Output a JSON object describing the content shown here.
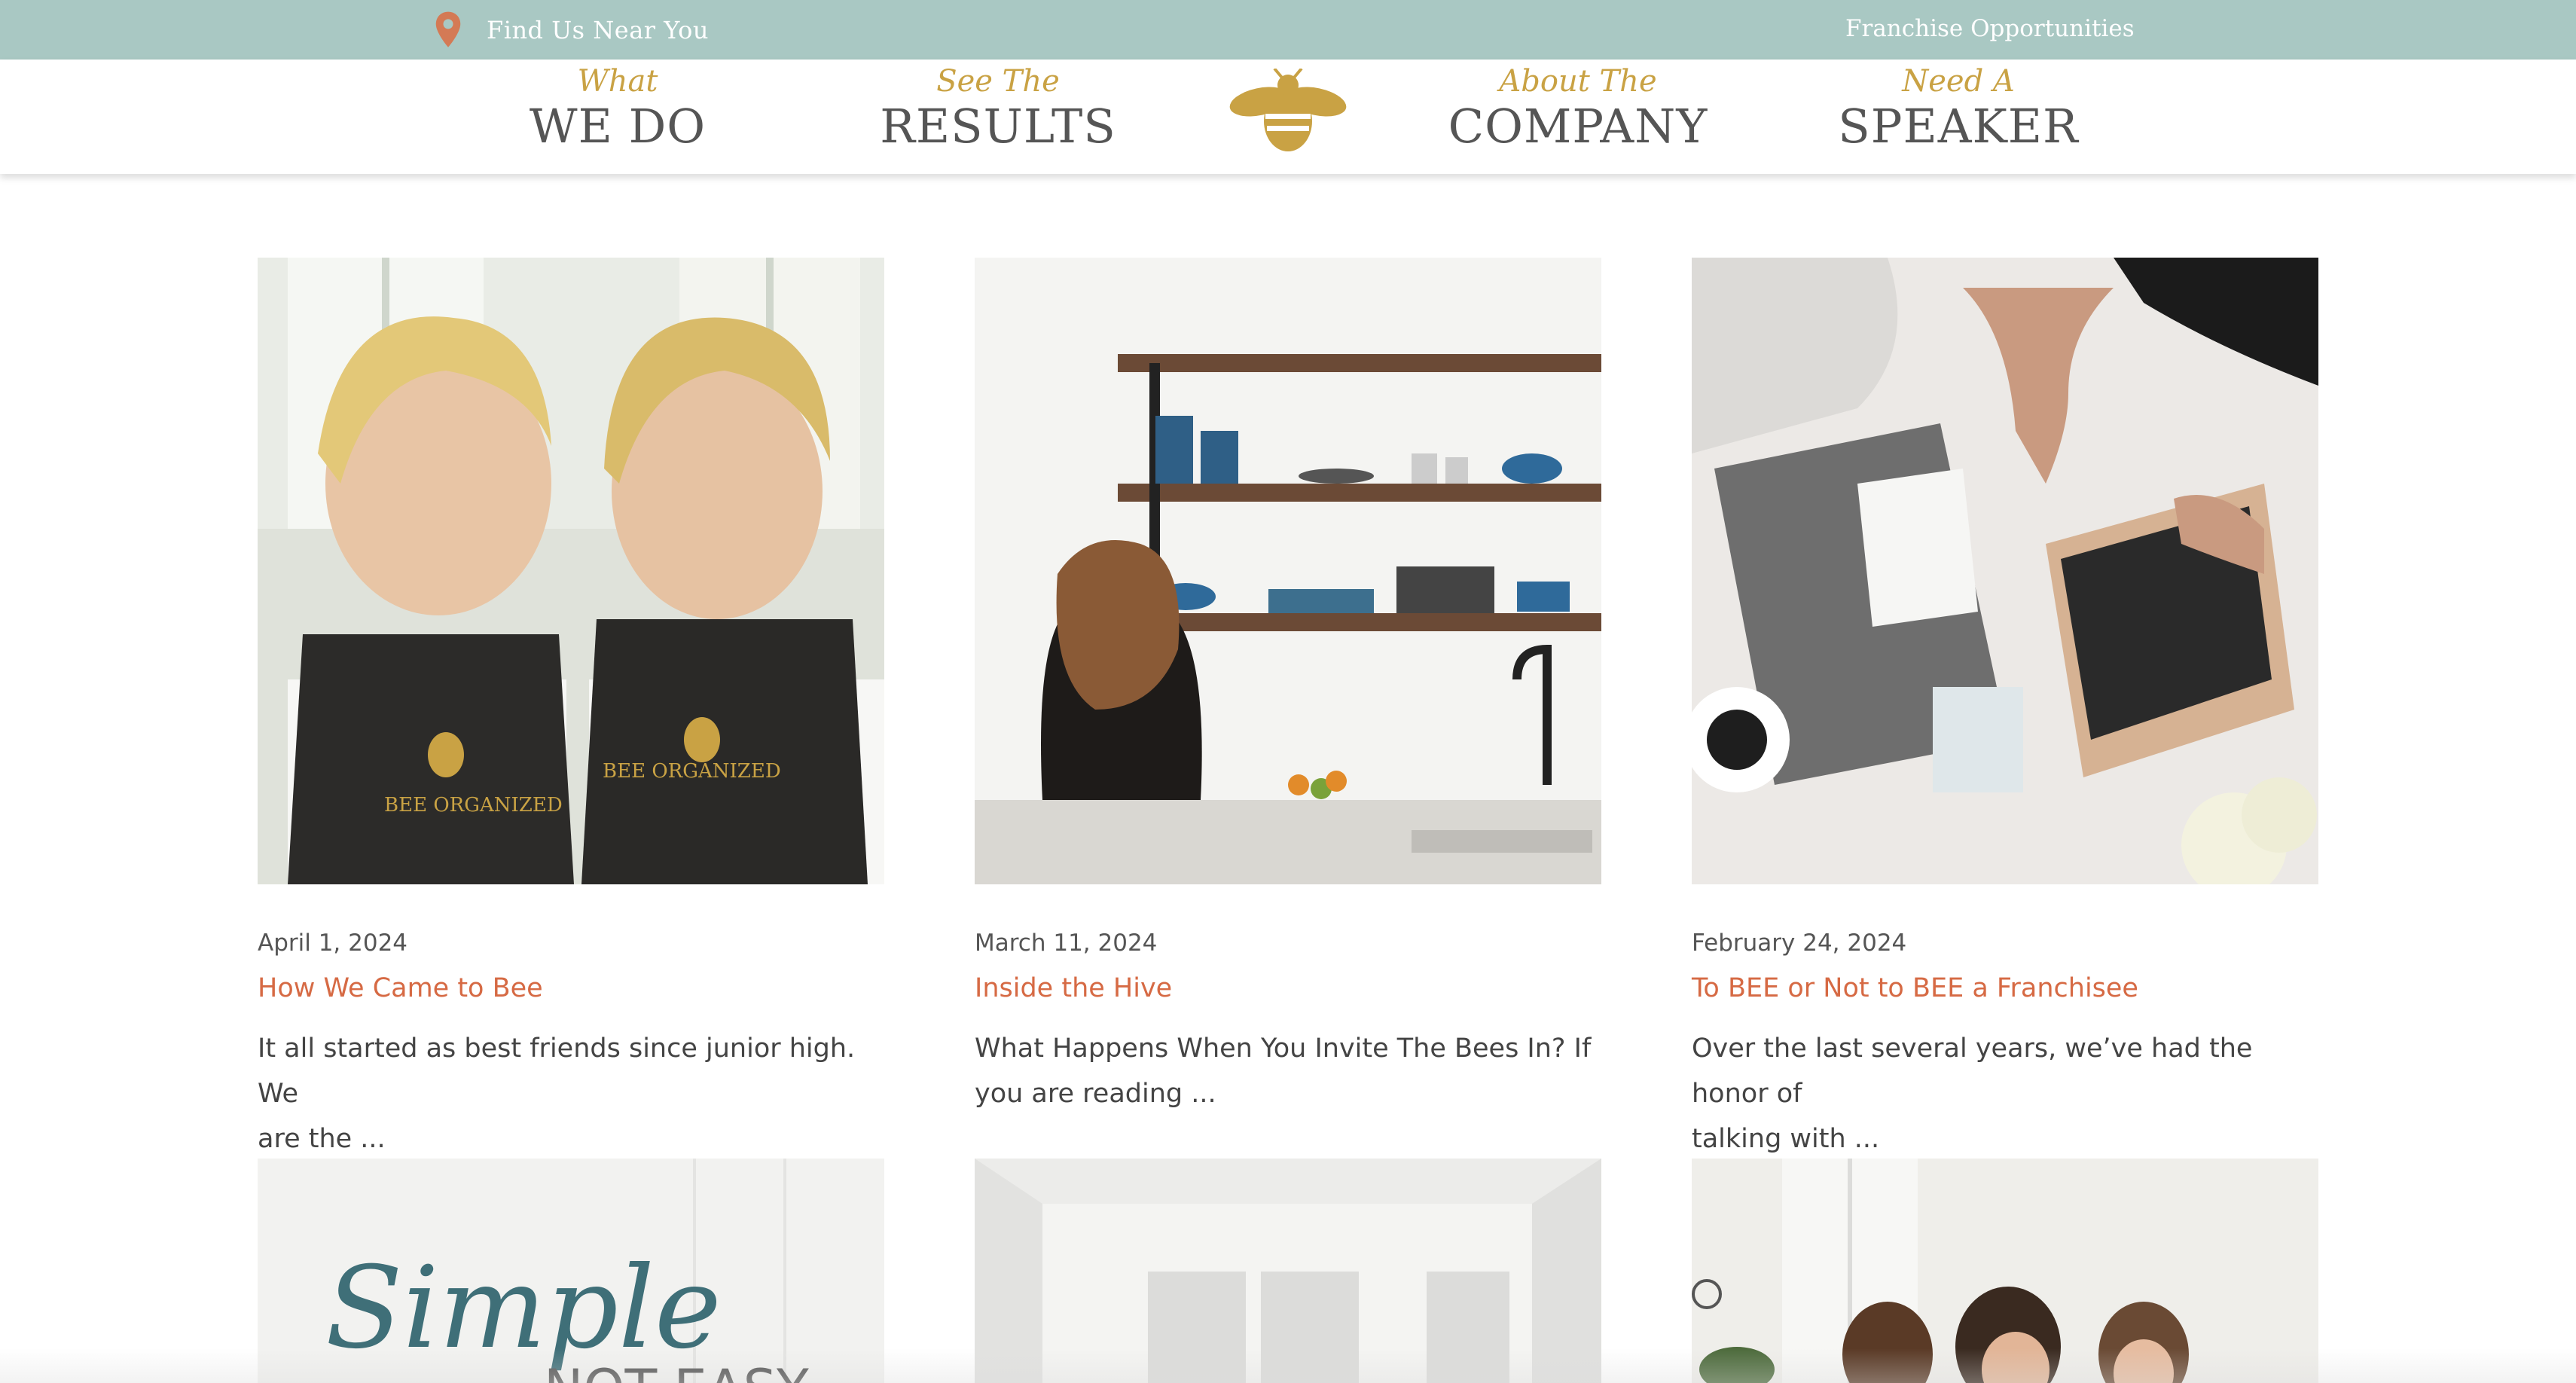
{
  "topbar": {
    "find_us": "Find Us Near You",
    "franchise": "Franchise Opportunities",
    "colors": {
      "bar": "#a9c8c3",
      "pin": "#d47a55"
    }
  },
  "nav": [
    {
      "script": "What",
      "main": "WE DO"
    },
    {
      "script": "See The",
      "main": "RESULTS"
    },
    {
      "script": "About The",
      "main": "COMPANY"
    },
    {
      "script": "Need A",
      "main": "SPEAKER"
    }
  ],
  "logo": {
    "icon": "bee-icon",
    "color": "#c9a244"
  },
  "posts": [
    {
      "date": "April 1, 2024",
      "title": "How We Came to Bee",
      "excerpt_line1": "It all started as best friends since junior high. We",
      "excerpt_line2": "are the ...",
      "image_text_1": "BEE ORGANIZED",
      "image_text_2": "BEE ORGANIZED"
    },
    {
      "date": "March 11, 2024",
      "title": "Inside the Hive",
      "excerpt_line1": "What Happens When You Invite The Bees In? If",
      "excerpt_line2": "you are reading ..."
    },
    {
      "date": "February 24, 2024",
      "title": "To BEE or Not to BEE a Franchisee",
      "excerpt_line1": "Over the last several years, we’ve had the honor of",
      "excerpt_line2": "talking with ..."
    }
  ],
  "second_row": {
    "image_text_script": "Simple",
    "image_text_caps": "NOT EASY"
  },
  "accent": {
    "link": "#d66a44",
    "gold": "#c9a244"
  }
}
